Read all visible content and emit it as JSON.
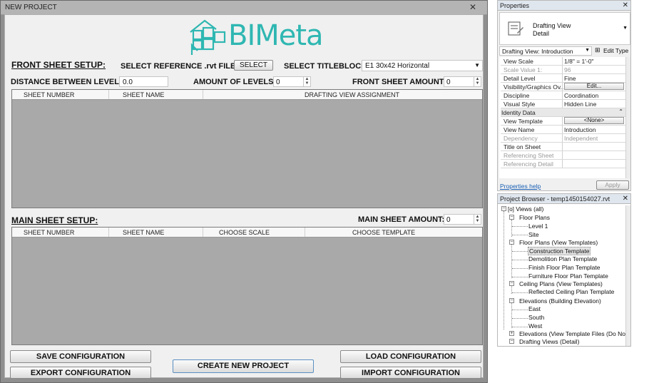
{
  "dialog": {
    "title": "NEW PROJECT",
    "close_symbol": "✕",
    "logo_text": "BIMeta",
    "front": {
      "header": "FRONT SHEET SETUP:",
      "select_reference_label": "SELECT REFERENCE .rvt FILE:",
      "select_button": "SELECT",
      "select_titleblock_label": "SELECT TITLEBLOCK:",
      "titleblock_value": "E1 30x42 Horizontal",
      "distance_label": "DISTANCE BETWEEN LEVELS:",
      "distance_value": "0.0",
      "amount_levels_label": "AMOUNT OF LEVELS:",
      "amount_levels_value": "0",
      "front_amount_label": "FRONT SHEET AMOUNT:",
      "front_amount_value": "0",
      "columns": [
        "SHEET NUMBER",
        "SHEET NAME",
        "DRAFTING VIEW ASSIGNMENT"
      ]
    },
    "main": {
      "header": "MAIN SHEET SETUP:",
      "amount_label": "MAIN SHEET AMOUNT:",
      "amount_value": "0",
      "columns": [
        "SHEET NUMBER",
        "SHEET NAME",
        "CHOOSE SCALE",
        "CHOOSE TEMPLATE"
      ]
    },
    "buttons": {
      "save": "SAVE CONFIGURATION",
      "export": "EXPORT CONFIGURATION",
      "create": "CREATE NEW PROJECT",
      "load": "LOAD CONFIGURATION",
      "import": "IMPORT CONFIGURATION"
    }
  },
  "properties": {
    "title": "Properties",
    "close_symbol": "✕",
    "type_line1": "Drafting View",
    "type_line2": "Detail",
    "selector": "Drafting View: Introduction",
    "edit_type": "Edit Type",
    "rows": [
      {
        "k": "View Scale",
        "v": "1/8\" = 1'-0\""
      },
      {
        "k": "Scale Value    1:",
        "v": "96"
      },
      {
        "k": "Detail Level",
        "v": "Fine"
      },
      {
        "k": "Visibility/Graphics Ov...",
        "v": "Edit..."
      },
      {
        "k": "Discipline",
        "v": "Coordination"
      },
      {
        "k": "Visual Style",
        "v": "Hidden Line"
      },
      {
        "k": "Identity Data",
        "v": ""
      },
      {
        "k": "View Template",
        "v": "<None>"
      },
      {
        "k": "View Name",
        "v": "Introduction"
      },
      {
        "k": "Dependency",
        "v": "Independent"
      },
      {
        "k": "Title on Sheet",
        "v": ""
      },
      {
        "k": "Referencing Sheet",
        "v": ""
      },
      {
        "k": "Referencing Detail",
        "v": ""
      }
    ],
    "help_link": "Properties help",
    "apply": "Apply"
  },
  "browser": {
    "title": "Project Browser - temp1450154027.rvt",
    "close_symbol": "✕",
    "nodes": [
      "Views (all)",
      "Floor Plans",
      "Level 1",
      "Site",
      "Floor Plans (View Templates)",
      "Construction Template",
      "Demolition Plan Template",
      "Finish Floor Plan Template",
      "Furniture Floor Plan Template",
      "Ceiling Plans (View Templates)",
      "Reflected Ceiling Plan Template",
      "Elevations (Building Elevation)",
      "East",
      "South",
      "West",
      "Elevations (View Template Files (Do Not Del",
      "Drafting Views (Detail)"
    ]
  }
}
